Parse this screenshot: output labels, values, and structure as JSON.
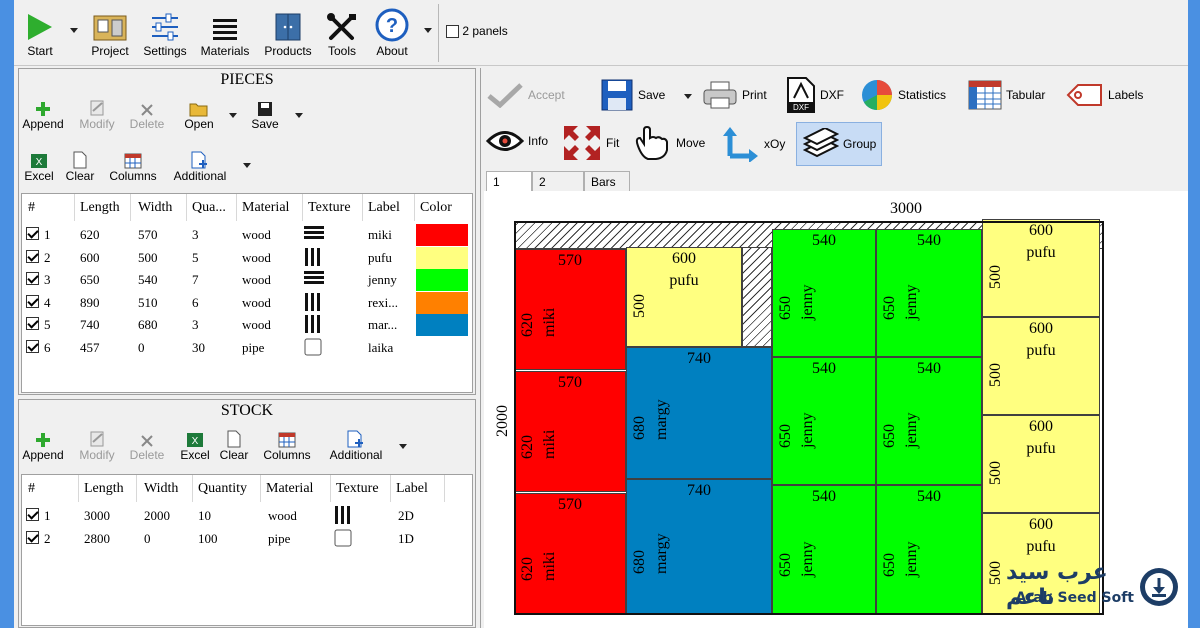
{
  "toolbar": {
    "start": "Start",
    "project": "Project",
    "settings": "Settings",
    "materials": "Materials",
    "products": "Products",
    "tools": "Tools",
    "about": "About",
    "two_panels": "2 panels"
  },
  "pieces": {
    "title": "PIECES",
    "buttons": {
      "append": "Append",
      "modify": "Modify",
      "delete": "Delete",
      "open": "Open",
      "save": "Save",
      "excel": "Excel",
      "clear": "Clear",
      "columns": "Columns",
      "additional": "Additional"
    },
    "headers": [
      "#",
      "Length",
      "Width",
      "Qua...",
      "Material",
      "Texture",
      "Label",
      "Color"
    ],
    "rows": [
      {
        "num": "1",
        "length": "620",
        "width": "570",
        "qty": "3",
        "material": "wood",
        "texture": "horizontal",
        "label": "miki",
        "color": "#ff0000"
      },
      {
        "num": "2",
        "length": "600",
        "width": "500",
        "qty": "5",
        "material": "wood",
        "texture": "vertical",
        "label": "pufu",
        "color": "#ffff80"
      },
      {
        "num": "3",
        "length": "650",
        "width": "540",
        "qty": "7",
        "material": "wood",
        "texture": "horizontal",
        "label": "jenny",
        "color": "#00ff00"
      },
      {
        "num": "4",
        "length": "890",
        "width": "510",
        "qty": "6",
        "material": "wood",
        "texture": "vertical",
        "label": "rexi...",
        "color": "#ff8000"
      },
      {
        "num": "5",
        "length": "740",
        "width": "680",
        "qty": "3",
        "material": "wood",
        "texture": "vertical",
        "label": "mar...",
        "color": "#0080c0"
      },
      {
        "num": "6",
        "length": "457",
        "width": "0",
        "qty": "30",
        "material": "pipe",
        "texture": "none",
        "label": "laika",
        "color": ""
      }
    ]
  },
  "stock": {
    "title": "STOCK",
    "buttons": {
      "append": "Append",
      "modify": "Modify",
      "delete": "Delete",
      "excel": "Excel",
      "clear": "Clear",
      "columns": "Columns",
      "additional": "Additional"
    },
    "headers": [
      "#",
      "Length",
      "Width",
      "Quantity",
      "Material",
      "Texture",
      "Label"
    ],
    "rows": [
      {
        "num": "1",
        "length": "3000",
        "width": "2000",
        "qty": "10",
        "material": "wood",
        "texture": "vertical",
        "label": "2D"
      },
      {
        "num": "2",
        "length": "2800",
        "width": "0",
        "qty": "100",
        "material": "pipe",
        "texture": "none",
        "label": "1D"
      }
    ]
  },
  "result_toolbar": {
    "accept": "Accept",
    "save": "Save",
    "print": "Print",
    "dxf": "DXF",
    "statistics": "Statistics",
    "tabular": "Tabular",
    "labels": "Labels",
    "info": "Info",
    "fit": "Fit",
    "move": "Move",
    "xoy": "xOy",
    "group": "Group"
  },
  "tabs": [
    "1",
    "2",
    "Bars"
  ],
  "layout": {
    "sheet_width": "3000",
    "sheet_height": "2000",
    "pieces": [
      {
        "w": "570",
        "h": "620",
        "label": "miki",
        "color": "#ff0000"
      },
      {
        "w": "570",
        "h": "620",
        "label": "miki",
        "color": "#ff0000"
      },
      {
        "w": "570",
        "h": "620",
        "label": "miki",
        "color": "#ff0000"
      },
      {
        "w": "600",
        "h": "500",
        "label": "pufu",
        "color": "#ffff80"
      },
      {
        "w": "740",
        "h": "680",
        "label": "margy",
        "color": "#0080c0"
      },
      {
        "w": "740",
        "h": "680",
        "label": "margy",
        "color": "#0080c0"
      },
      {
        "w": "540",
        "h": "650",
        "label": "jenny",
        "color": "#00ff00"
      },
      {
        "w": "540",
        "h": "650",
        "label": "jenny",
        "color": "#00ff00"
      },
      {
        "w": "540",
        "h": "650",
        "label": "jenny",
        "color": "#00ff00"
      },
      {
        "w": "540",
        "h": "650",
        "label": "jenny",
        "color": "#00ff00"
      },
      {
        "w": "540",
        "h": "650",
        "label": "jenny",
        "color": "#00ff00"
      },
      {
        "w": "540",
        "h": "650",
        "label": "jenny",
        "color": "#00ff00"
      },
      {
        "w": "600",
        "h": "500",
        "label": "pufu",
        "color": "#ffff80"
      },
      {
        "w": "600",
        "h": "500",
        "label": "pufu",
        "color": "#ffff80"
      },
      {
        "w": "600",
        "h": "500",
        "label": "pufu",
        "color": "#ffff80"
      },
      {
        "w": "600",
        "h": "500",
        "label": "pufu",
        "color": "#ffff80"
      }
    ]
  },
  "watermark": {
    "arabic": "عرب سيد ناعم",
    "latin": "Arab Seed Soft"
  }
}
